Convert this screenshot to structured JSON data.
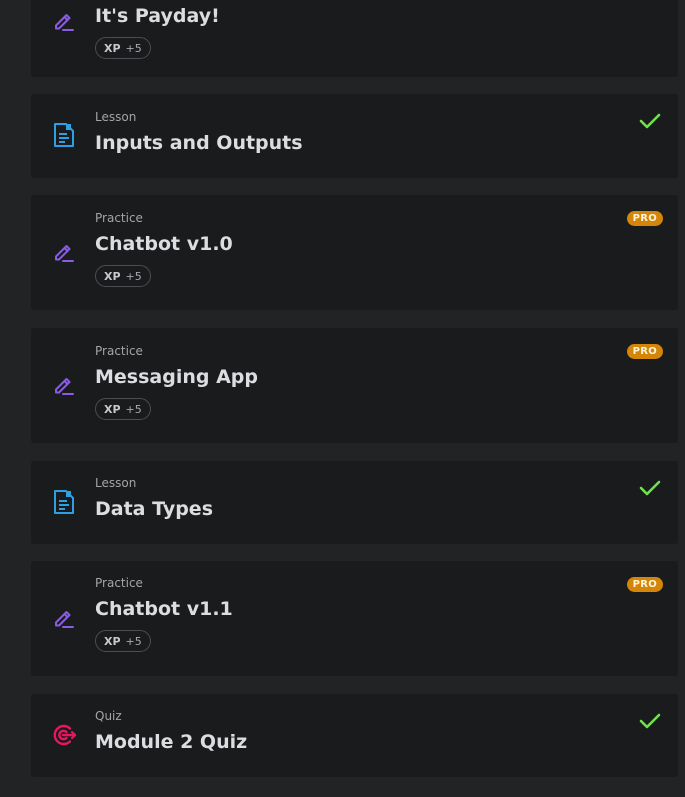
{
  "colors": {
    "practice_icon": "#8a5ce6",
    "lesson_icon": "#2f9fe4",
    "quiz_icon": "#e8175d",
    "check": "#6fe34a",
    "pro_badge": "#d4860a"
  },
  "items": [
    {
      "kind": "",
      "title": "It's Payday!",
      "xp_label": "XP",
      "xp_value": "+5",
      "icon": "pencil-icon"
    },
    {
      "kind": "Lesson",
      "title": "Inputs and Outputs",
      "icon": "document-icon",
      "status": "completed"
    },
    {
      "kind": "Practice",
      "title": "Chatbot v1.0",
      "xp_label": "XP",
      "xp_value": "+5",
      "badge": "PRO",
      "icon": "pencil-icon"
    },
    {
      "kind": "Practice",
      "title": "Messaging App",
      "xp_label": "XP",
      "xp_value": "+5",
      "badge": "PRO",
      "icon": "pencil-icon"
    },
    {
      "kind": "Lesson",
      "title": "Data Types",
      "icon": "document-icon",
      "status": "completed"
    },
    {
      "kind": "Practice",
      "title": "Chatbot v1.1",
      "xp_label": "XP",
      "xp_value": "+5",
      "badge": "PRO",
      "icon": "pencil-icon"
    },
    {
      "kind": "Quiz",
      "title": "Module 2 Quiz",
      "icon": "target-icon",
      "status": "completed"
    }
  ]
}
